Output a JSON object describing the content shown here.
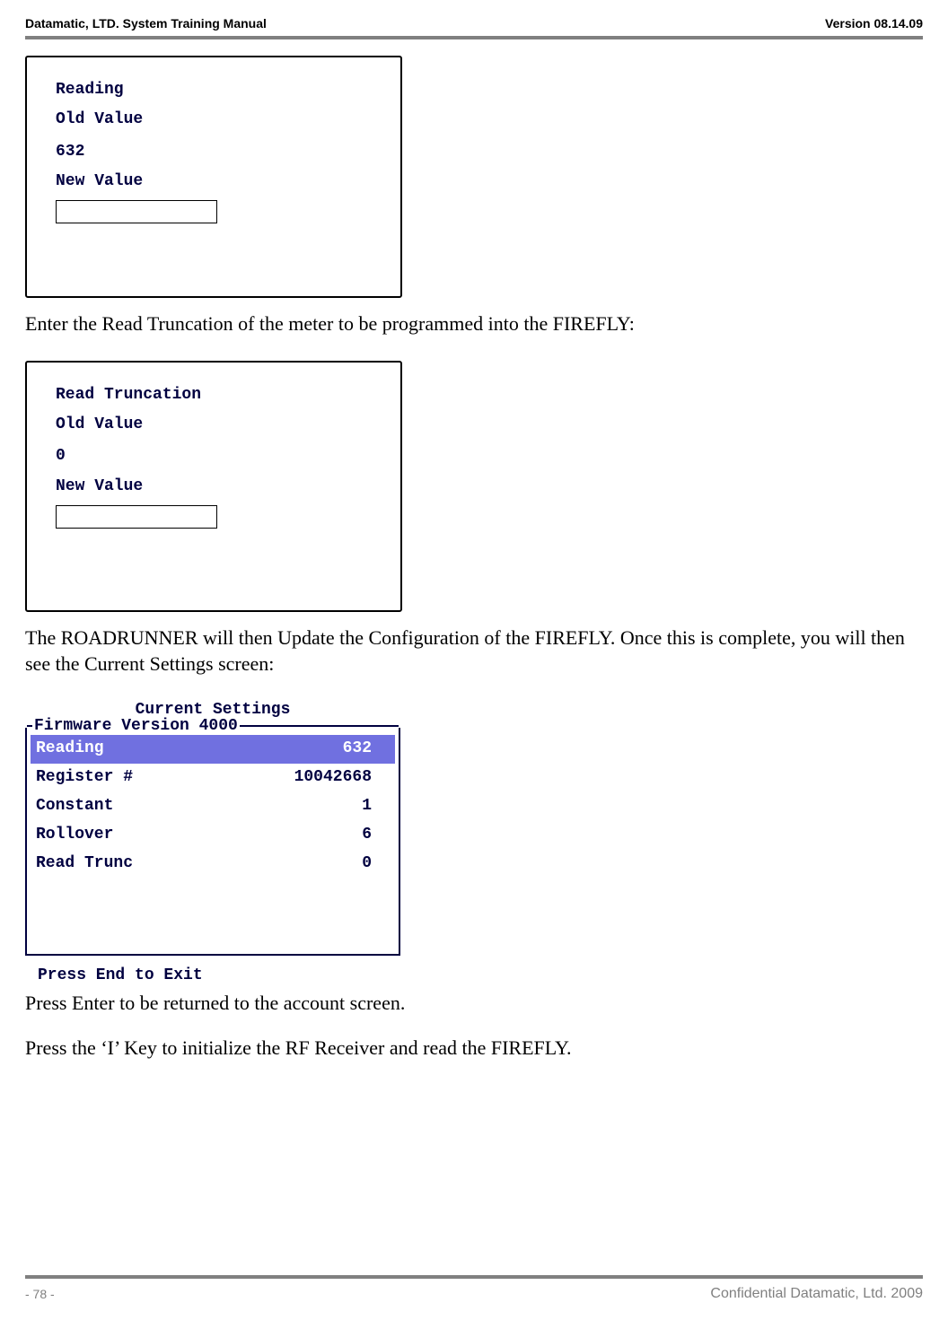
{
  "header": {
    "left": "Datamatic, LTD. System Training  Manual",
    "right": "Version 08.14.09"
  },
  "screenshot1": {
    "line1": "Reading",
    "line2": "Old Value",
    "line3": "632",
    "line4": "New Value",
    "input_value": ""
  },
  "paragraph1": "Enter the Read Truncation of the meter to be programmed into the FIREFLY:",
  "screenshot2": {
    "line1": "Read Truncation",
    "line2": "Old Value",
    "line3": "0",
    "line4": "New Value",
    "input_value": ""
  },
  "paragraph2": "The ROADRUNNER will then Update the Configuration of the FIREFLY. Once this is complete, you will then see the Current Settings screen:",
  "screenshot3": {
    "title": "Current Settings",
    "legend": "Firmware Version 4000",
    "rows": [
      {
        "label": "Reading",
        "value": "632",
        "highlight": true
      },
      {
        "label": "Register #",
        "value": "10042668",
        "highlight": false
      },
      {
        "label": "Constant",
        "value": "1",
        "highlight": false
      },
      {
        "label": "Rollover",
        "value": "6",
        "highlight": false
      },
      {
        "label": "Read Trunc",
        "value": "0",
        "highlight": false
      }
    ],
    "footer": "Press End to Exit"
  },
  "paragraph3": "Press Enter to be returned to the account screen.",
  "paragraph4": "Press the ‘I’ Key to initialize the RF Receiver and read the FIREFLY.",
  "footer": {
    "left": "- 78 -",
    "right": "Confidential Datamatic, Ltd. 2009"
  }
}
